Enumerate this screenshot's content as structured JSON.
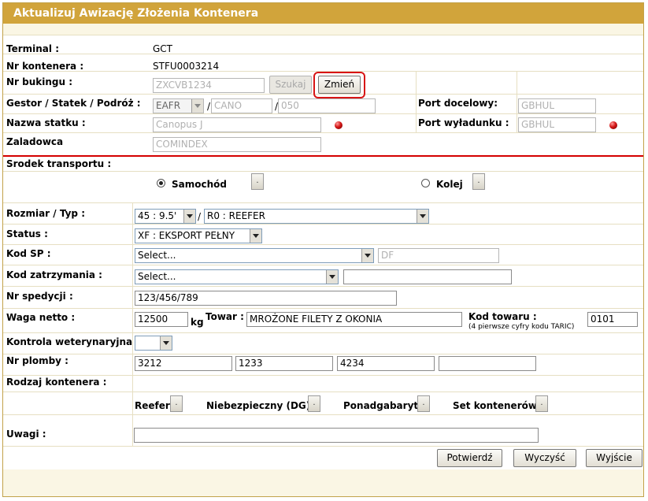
{
  "window": {
    "title": "Aktualizuj Awizację Złożenia Kontenera"
  },
  "info": {
    "terminal_label": "Terminal :",
    "terminal_value": "GCT",
    "container_label": "Nr kontenera :",
    "container_value": "STFU0003214",
    "booking_label": "Nr bukingu :",
    "booking_value": "ZXCVB1234",
    "search_button": "Szukaj",
    "change_button": "Zmień",
    "gestor_label": "Gestor / Statek / Podróż :",
    "gestor_value": "EAFR",
    "slash": "/",
    "ship_code_value": "CANO",
    "voyage_value": "050",
    "port_dest_label": "Port docelowy:",
    "port_dest_value": "GBHUL",
    "ship_name_label": "Nazwa statku :",
    "ship_name_value": "Canopus J",
    "port_unload_label": "Port wyładunku :",
    "port_unload_value": "GBHUL",
    "shipper_label": "Zaladowca",
    "shipper_value": "COMINDEX"
  },
  "transport": {
    "label": "Srodek transportu :",
    "options": [
      {
        "label": "Samochód",
        "selected": true
      },
      {
        "label": "Kolej",
        "selected": false
      }
    ],
    "dot_button": "."
  },
  "form": {
    "size_type_label": "Rozmiar / Typ :",
    "size_value": "45 : 9.5'",
    "type_value": "R0 : REEFER",
    "status_label": "Status :",
    "status_value": "XF : EKSPORT PEŁNY",
    "kod_sp_label": "Kod SP :",
    "kod_sp_value": "Select...",
    "kod_sp_code": "DF",
    "kod_zatrz_label": "Kod zatrzymania :",
    "kod_zatrz_value": "Select...",
    "kod_zatrz_text": "",
    "nr_sped_label": "Nr spedycji :",
    "nr_sped_value": "123/456/789",
    "weight_label": "Waga netto :",
    "weight_value": "12500",
    "weight_unit": "kg",
    "goods_label": "Towar :",
    "goods_value": "MROŻONE FILETY Z OKONIA",
    "goods_code_label": "Kod towaru :",
    "goods_code_hint": "(4 pierwsze cyfry kodu TARIC)",
    "goods_code_value": "0101",
    "vet_label": "Kontrola weterynaryjna :",
    "vet_value": "",
    "seals_label": "Nr plomby :",
    "seals": [
      "3212",
      "1233",
      "4234",
      ""
    ],
    "container_kind_label": "Rodzaj kontenera :",
    "kinds": [
      "Reefer",
      "Niebezpieczny (DG)",
      "Ponadgabaryt",
      "Set kontenerów"
    ],
    "notes_label": "Uwagi :",
    "notes_value": ""
  },
  "actions": {
    "confirm": "Potwierdź",
    "clear": "Wyczyść",
    "exit": "Wyjście"
  },
  "colors": {
    "title_bar": "#d1a43b",
    "highlight": "#d81515",
    "separator": "#d40000"
  }
}
